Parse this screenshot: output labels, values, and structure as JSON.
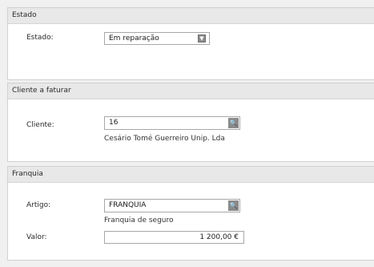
{
  "estado_panel": {
    "header": "Estado",
    "label": "Estado:",
    "value": "Em reparação",
    "dropdown_icon": "chevron-down"
  },
  "cliente_panel": {
    "header": "Cliente a faturar",
    "label": "Cliente:",
    "value": "16",
    "description": "Cesário Tomé Guerreiro Unip. Lda",
    "lookup_icon": "search"
  },
  "franquia_panel": {
    "header": "Franquia",
    "artigo_label": "Artigo:",
    "artigo_value": "FRANQUIA",
    "artigo_description": "Franquia de seguro",
    "valor_label": "Valor:",
    "valor_value": "1 200,00 €"
  }
}
